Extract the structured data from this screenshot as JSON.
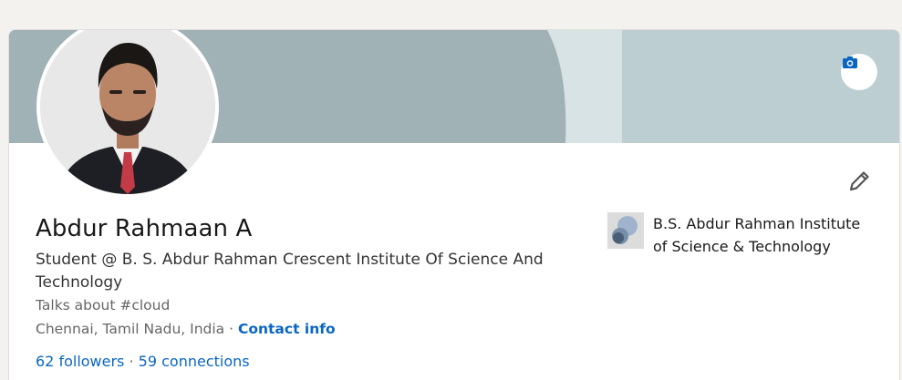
{
  "profile": {
    "name": "Abdur Rahmaan A",
    "headline": "Student @ B. S. Abdur Rahman Crescent Institute Of Science And Technology",
    "talks_about": "Talks about #cloud",
    "location": "Chennai, Tamil Nadu, India",
    "location_separator": " · ",
    "contact_info_label": "Contact info",
    "followers": "62 followers",
    "network_separator": " · ",
    "connections": "59 connections"
  },
  "education": {
    "name": "B.S. Abdur Rahman Institute of Science & Technology"
  },
  "icons": {
    "camera": "camera-icon",
    "edit": "pencil-icon"
  },
  "colors": {
    "link": "#0a66c2",
    "banner": "#a0b2b6",
    "page_bg": "#f3f2ef"
  }
}
